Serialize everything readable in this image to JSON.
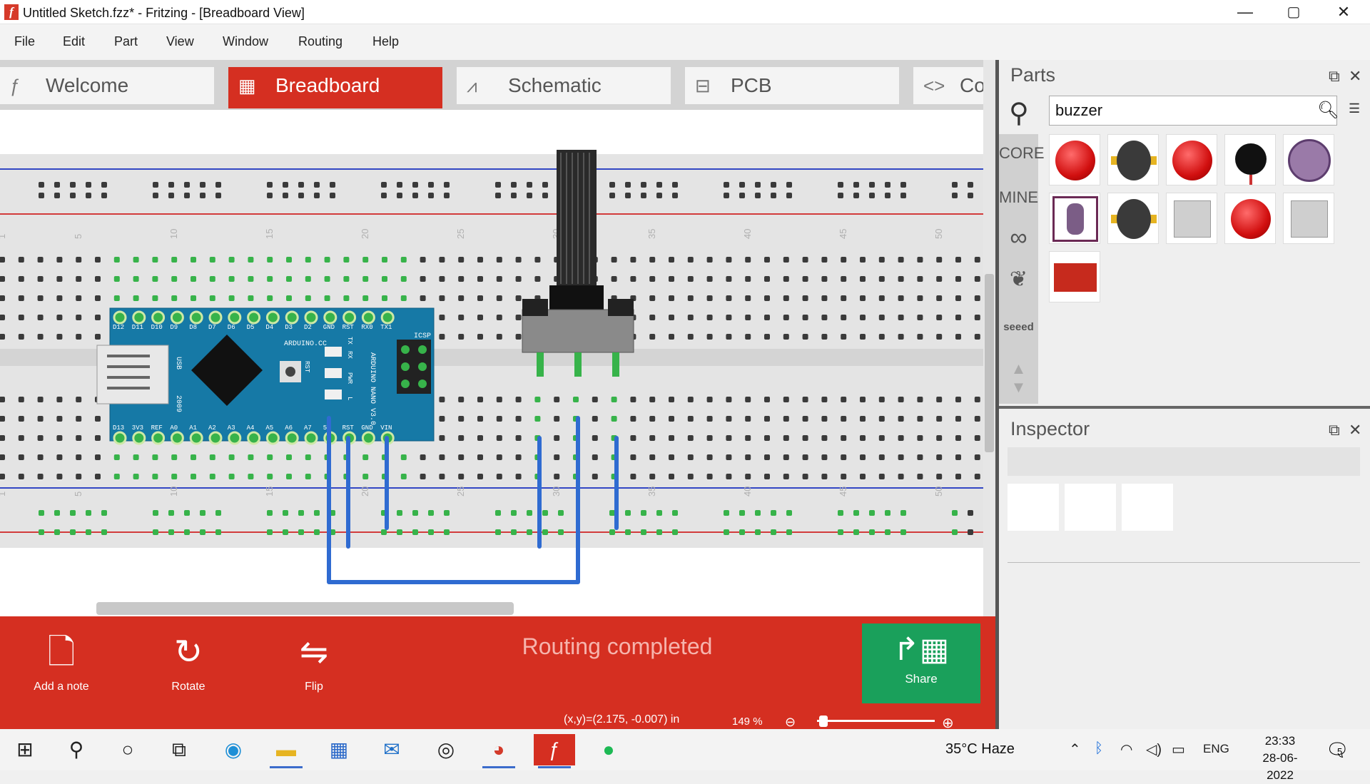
{
  "window": {
    "title": "Untitled Sketch.fzz* - Fritzing - [Breadboard View]",
    "app_icon": "f",
    "minimize": "—",
    "maximize": "▢",
    "close": "✕"
  },
  "menu": [
    "File",
    "Edit",
    "Part",
    "View",
    "Window",
    "Routing",
    "Help"
  ],
  "tabs": [
    {
      "label": "Welcome",
      "icon": "ƒ",
      "active": false
    },
    {
      "label": "Breadboard",
      "icon": "▦",
      "active": true
    },
    {
      "label": "Schematic",
      "icon": "⩘",
      "active": false
    },
    {
      "label": "PCB",
      "icon": "⊟",
      "active": false
    },
    {
      "label": "Cod",
      "icon": "<>",
      "active": false
    }
  ],
  "breadboard": {
    "column_labels_top": [
      "1",
      "5",
      "10",
      "15",
      "20",
      "25",
      "30",
      "35",
      "40",
      "45",
      "50"
    ],
    "arduino": {
      "name": "ARDUINO NANO V3.0",
      "site": "ARDUINO.CC",
      "top_pins": [
        "D12",
        "D11",
        "D10",
        "D9",
        "D8",
        "D7",
        "D6",
        "D5",
        "D4",
        "D3",
        "D2",
        "GND",
        "RST",
        "RX0",
        "TX1"
      ],
      "bottom_pins": [
        "D13",
        "3V3",
        "REF",
        "A0",
        "A1",
        "A2",
        "A3",
        "A4",
        "A5",
        "A6",
        "A7",
        "5V",
        "RST",
        "GND",
        "VIN"
      ],
      "year": "2009",
      "usb": "USB",
      "icsp": "ICSP",
      "rst": "RST",
      "tx": "TX",
      "rx": "RX",
      "pwr": "PWR",
      "l": "L"
    },
    "colors": {
      "board": "#e3e3e3",
      "hole": "#3a3a3a",
      "connected_hole": "#37b34a",
      "wire": "#2f6bd1",
      "rail_blue": "#3347c4",
      "rail_red": "#d23b3b",
      "nano": "#1679a6"
    }
  },
  "toolbar": {
    "add_note": {
      "label": "Add a note",
      "icon": "note-icon"
    },
    "rotate": {
      "label": "Rotate",
      "icon": "rotate-icon"
    },
    "flip": {
      "label": "Flip",
      "icon": "flip-icon"
    },
    "status": "Routing completed",
    "share": {
      "label": "Share",
      "icon": "share-icon"
    }
  },
  "statusbar": {
    "coords": "(x,y)=(2.175, -0.007) in",
    "zoom": "149 %",
    "zoom_out": "⊖",
    "zoom_in": "⊕"
  },
  "parts": {
    "title": "Parts",
    "search_value": "buzzer",
    "bins": [
      "CORE",
      "MINE",
      "∞",
      "❦",
      "seeed"
    ],
    "results": [
      {
        "kind": "red-button"
      },
      {
        "kind": "buzzer-yellow"
      },
      {
        "kind": "red-button"
      },
      {
        "kind": "buzzer-small"
      },
      {
        "kind": "purple-module"
      },
      {
        "kind": "purple-buzzer"
      },
      {
        "kind": "buzzer-yellow"
      },
      {
        "kind": "gray-module"
      },
      {
        "kind": "red-button"
      },
      {
        "kind": "gray-module"
      },
      {
        "kind": "red-board"
      }
    ]
  },
  "inspector": {
    "title": "Inspector"
  },
  "taskbar": {
    "weather": "35°C  Haze",
    "lang": "ENG",
    "time": "23:33",
    "date": "28-06-2022",
    "notifications": "5"
  }
}
